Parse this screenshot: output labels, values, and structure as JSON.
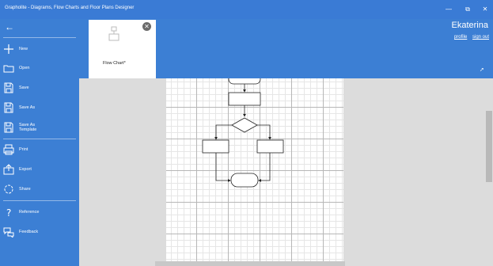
{
  "window": {
    "title": "Grapholite - Diagrams, Flow Charts and Floor Plans Designer"
  },
  "sidebar": {
    "items": [
      {
        "label": "New",
        "icon": "plus-icon"
      },
      {
        "label": "Open",
        "icon": "folder-icon"
      },
      {
        "label": "Save",
        "icon": "save-icon"
      },
      {
        "label": "Save As",
        "icon": "save-as-icon"
      },
      {
        "label": "Save As Template",
        "icon": "save-template-icon"
      },
      {
        "label": "Print",
        "icon": "print-icon"
      },
      {
        "label": "Export",
        "icon": "export-icon"
      },
      {
        "label": "Share",
        "icon": "share-icon"
      },
      {
        "label": "Reference",
        "icon": "question-icon"
      },
      {
        "label": "Feedback",
        "icon": "feedback-icon"
      }
    ]
  },
  "documents": [
    {
      "name": "Flow Chart*"
    }
  ],
  "user": {
    "name": "Ekaterina",
    "profile_label": "profile",
    "signout_label": "sign out"
  },
  "colors": {
    "accent": "#3c7fd4",
    "workspace": "#dcdcdc"
  }
}
